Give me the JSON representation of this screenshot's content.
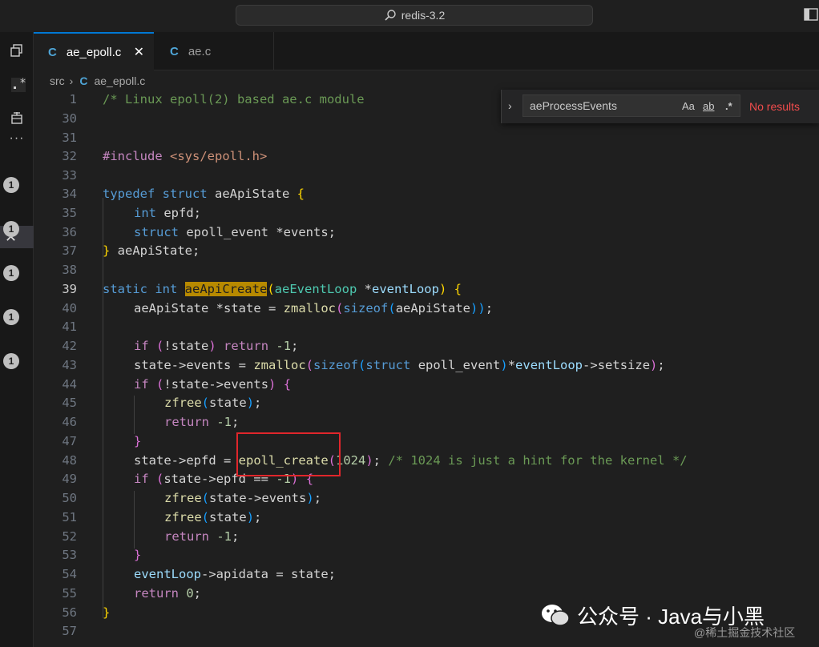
{
  "window": {
    "search_text": "redis-3.2"
  },
  "tabs": [
    {
      "icon": "C",
      "label": "ae_epoll.c",
      "close": "✕"
    },
    {
      "icon": "C",
      "label": "ae.c"
    }
  ],
  "breadcrumb": {
    "folder": "src",
    "sep": "›",
    "icon": "C",
    "file": "ae_epoll.c"
  },
  "activity": {
    "badges": [
      "1",
      "1",
      "1",
      "1",
      "1"
    ],
    "close": "✕",
    "more": "···"
  },
  "find": {
    "value": "aeProcessEvents",
    "match_case": "Aa",
    "whole_word": "ab",
    "regex": ".*",
    "status": "No results"
  },
  "lines": {
    "n1": "1",
    "c1": "/* Linux epoll(2) based ae.c module",
    "n30": "30",
    "n31": "31",
    "n32": "32",
    "c32a": "#include ",
    "c32b": "<sys/epoll.h>",
    "n33": "33",
    "n34": "34",
    "c34a": "typedef struct ",
    "c34b": "aeApiState ",
    "c34c": "{",
    "n35": "35",
    "c35a": "int ",
    "c35b": "epfd",
    "c35c": ";",
    "n36": "36",
    "c36a": "struct ",
    "c36b": "epoll_event ",
    "c36c": "*",
    "c36d": "events",
    "c36e": ";",
    "n37": "37",
    "c37a": "} ",
    "c37b": "aeApiState",
    "c37c": ";",
    "n38": "38",
    "n39": "39",
    "c39a": "static int ",
    "c39b": "aeApiCreate",
    "c39c": "(",
    "c39d": "aeEventLoop ",
    "c39e": "*",
    "c39f": "eventLoop",
    "c39g": ") ",
    "c39h": "{",
    "n40": "40",
    "c40a": "aeApiState ",
    "c40b": "*",
    "c40c": "state",
    "c40d": " = ",
    "c40e": "zmalloc",
    "c40f": "(",
    "c40g": "sizeof",
    "c40h": "(",
    "c40i": "aeApiState",
    "c40j": "))",
    "c40k": ";",
    "n41": "41",
    "n42": "42",
    "c42a": "if ",
    "c42b": "(",
    "c42c": "!",
    "c42d": "state",
    "c42e": ") ",
    "c42f": "return ",
    "c42g": "-1",
    "c42h": ";",
    "n43": "43",
    "c43a": "state",
    "c43b": "->",
    "c43c": "events",
    "c43d": " = ",
    "c43e": "zmalloc",
    "c43f": "(",
    "c43g": "sizeof",
    "c43h": "(",
    "c43i": "struct ",
    "c43j": "epoll_event",
    "c43k": ")",
    "c43l": "*",
    "c43m": "eventLoop",
    "c43n": "->",
    "c43o": "setsize",
    "c43p": ")",
    "c43q": ";",
    "n44": "44",
    "c44a": "if ",
    "c44b": "(",
    "c44c": "!",
    "c44d": "state",
    "c44e": "->",
    "c44f": "events",
    "c44g": ") ",
    "c44h": "{",
    "n45": "45",
    "c45a": "zfree",
    "c45b": "(",
    "c45c": "state",
    "c45d": ")",
    "c45e": ";",
    "n46": "46",
    "c46a": "return ",
    "c46b": "-1",
    "c46c": ";",
    "n47": "47",
    "c47a": "}",
    "n48": "48",
    "c48a": "state",
    "c48b": "->",
    "c48c": "epfd",
    "c48d": " = ",
    "c48e": "epoll_create",
    "c48f": "(",
    "c48g": "1024",
    "c48h": ")",
    "c48i": "; ",
    "c48j": "/* 1024 is just a hint for the kernel */",
    "n49": "49",
    "c49a": "if ",
    "c49b": "(",
    "c49c": "state",
    "c49d": "->",
    "c49e": "epfd",
    "c49f": " == ",
    "c49g": "-1",
    "c49h": ") ",
    "c49i": "{",
    "n50": "50",
    "c50a": "zfree",
    "c50b": "(",
    "c50c": "state",
    "c50d": "->",
    "c50e": "events",
    "c50f": ")",
    "c50g": ";",
    "n51": "51",
    "c51a": "zfree",
    "c51b": "(",
    "c51c": "state",
    "c51d": ")",
    "c51e": ";",
    "n52": "52",
    "c52a": "return ",
    "c52b": "-1",
    "c52c": ";",
    "n53": "53",
    "c53a": "}",
    "n54": "54",
    "c54a": "eventLoop",
    "c54b": "->",
    "c54c": "apidata",
    "c54d": " = ",
    "c54e": "state",
    "c54f": ";",
    "n55": "55",
    "c55a": "return ",
    "c55b": "0",
    "c55c": ";",
    "n56": "56",
    "c56a": "}",
    "n57": "57"
  },
  "watermark": {
    "main": "公众号 · Java与小黑",
    "sub": "@稀土掘金技术社区"
  },
  "colors": {
    "accent": "#0078d4",
    "error": "#f14c4c",
    "highlight": "#b88a00",
    "annotation_box": "#e0262b"
  }
}
